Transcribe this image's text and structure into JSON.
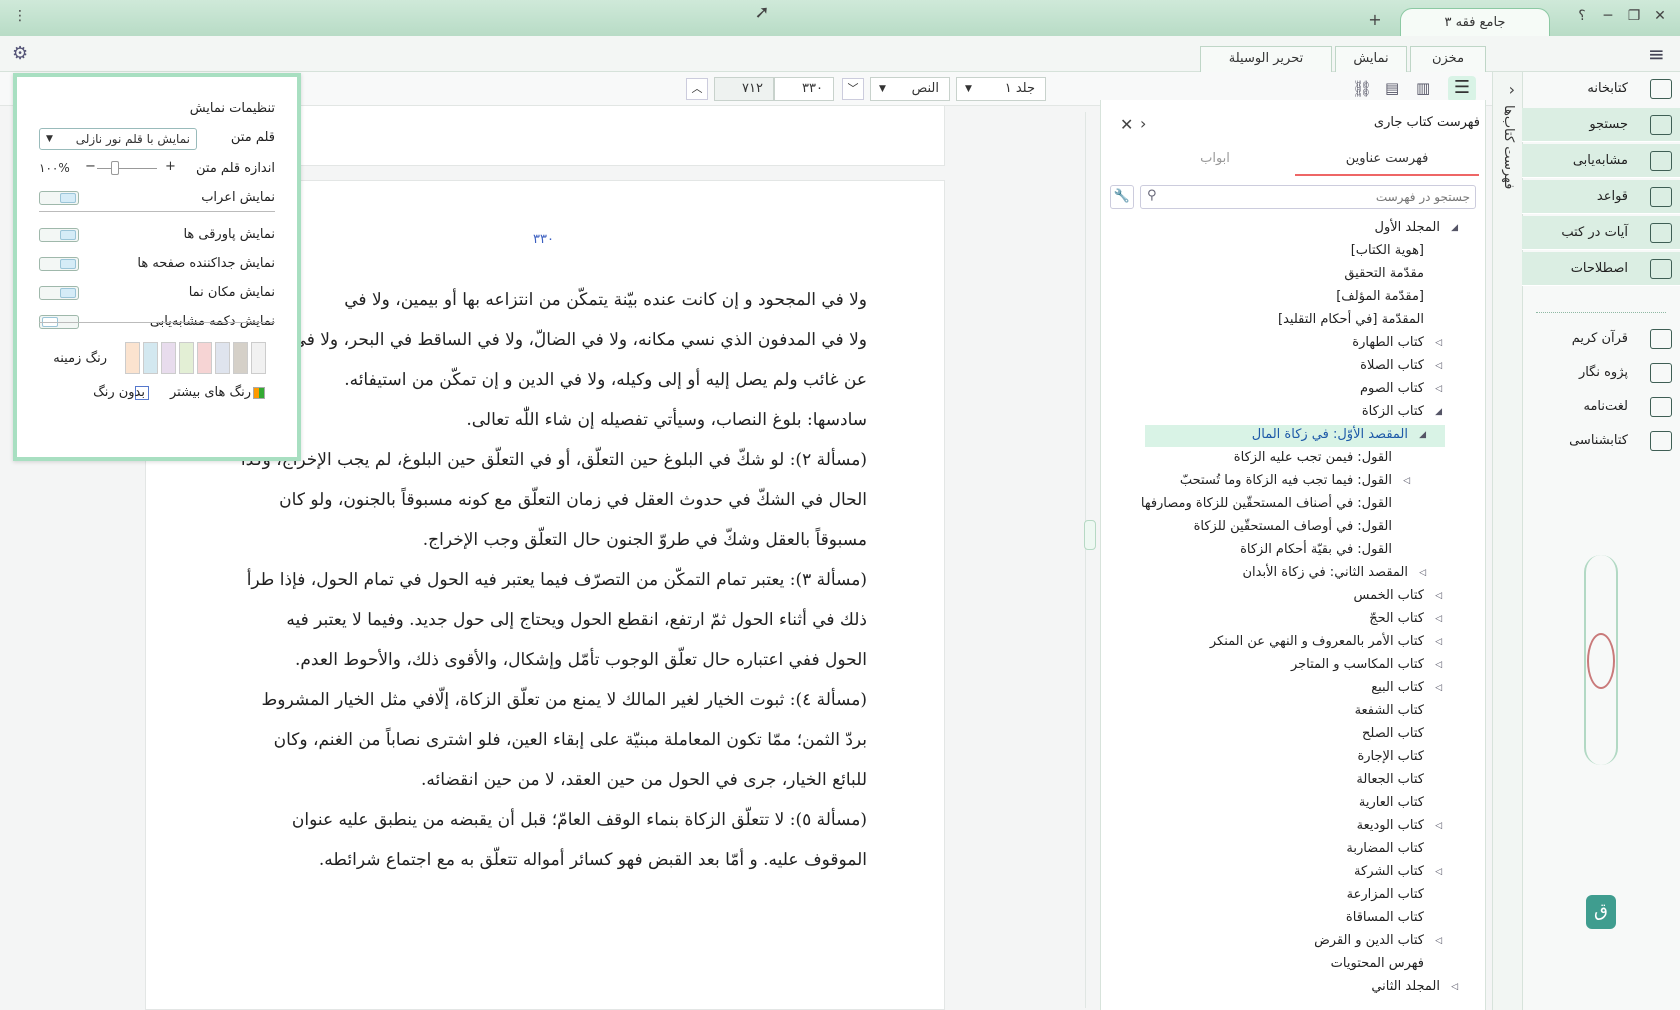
{
  "window": {
    "title": "جامع فقه ۳",
    "add_tab": "+",
    "help": "؟",
    "menu": "⋮"
  },
  "top_tabs": {
    "store": "مخزن",
    "display": "نمایش",
    "tahrir": "تحرير الوسيلة"
  },
  "sidebar": {
    "items": [
      {
        "label": "کتابخانه",
        "icon": "library-icon"
      },
      {
        "label": "جستجو",
        "icon": "search-icon"
      },
      {
        "label": "مشابه‌یابی",
        "icon": "similarity-icon"
      },
      {
        "label": "قواعد",
        "icon": "rules-icon"
      },
      {
        "label": "آیات در کتب",
        "icon": "verses-icon"
      },
      {
        "label": "اصطلاحات",
        "icon": "terms-icon"
      },
      {
        "label": "قرآن کریم",
        "icon": "quran-icon"
      },
      {
        "label": "پژوه نگار",
        "icon": "notes-icon"
      },
      {
        "label": "لغت‌نامه",
        "icon": "dictionary-icon"
      },
      {
        "label": "کتابشناسی",
        "icon": "bibliography-icon"
      }
    ]
  },
  "vertical_tab": "فهرست کتاب‌ها",
  "toc": {
    "title": "فهرست کتاب جاری",
    "tabs": [
      "فهرست عناوین",
      "ابواب"
    ],
    "search_placeholder": "جستجو در فهرست",
    "items": [
      "المجلد الأول",
      "[هوية الكتاب]",
      "مقدّمة التحقيق",
      "[مقدّمة المؤلف]",
      "المقدّمة [في أحكام التقليد]",
      "كتاب الطهارة",
      "كتاب الصلاة",
      "كتاب الصوم",
      "كتاب الزكاة",
      "المقصد الأوّل: في زكاة المال",
      "القول: فيمن تجب عليه الزكاة",
      "القول: فيما تجب فيه الزكاة وما تُستحبّ",
      "القول: في أصناف المستحقّين للزكاة ومصارفها",
      "القول: في أوصاف المستحقّين للزكاة",
      "القول: في بقيّة أحكام الزكاة",
      "المقصد الثاني: في زكاة الأبدان",
      "كتاب الخمس",
      "كتاب الحجّ",
      "كتاب الأمر بالمعروف و النهي عن المنكر",
      "كتاب المكاسب و المتاجر",
      "كتاب البيع",
      "كتاب الشفعة",
      "كتاب الصلح",
      "كتاب الإجارة",
      "كتاب الجعالة",
      "كتاب العارية",
      "كتاب الوديعة",
      "كتاب المضاربة",
      "كتاب الشركة",
      "كتاب المزارعة",
      "كتاب المساقاة",
      "كتاب الدين و القرض",
      "فهرس المحتويات",
      "المجلد الثاني"
    ]
  },
  "nav": {
    "volume": "جلد ۱",
    "section": "النص",
    "page": "۳۳۰",
    "total": "۷۱۲"
  },
  "page_number": "۳۳۰",
  "text_lines": [
    "ولا في المجحود و إن كانت عنده بيّنة يتمكّن من انتزاعه بها أو بيمين، ولا في",
    "ولا في المدفون الذي نسي مكانه، ولا في الضالّ، ولا في الساقط في البحر، ولا في",
    "عن غائب ولم يصل إليه أو إلى وكيله، ولا في الدين و إن تمكّن من استيفائه.",
    "سادسها: بلوغ النصاب، وسيأتي تفصيله إن شاء اللّٰه تعالى.",
    "(مسألة ٢): لو شكّ في البلوغ حين التعلّق، أو في التعلّق حين البلوغ، لم يجب الإخراج، وكذا",
    "الحال في الشكّ في حدوث العقل في زمان التعلّق مع كونه مسبوقاً بالجنون، ولو كان",
    "مسبوقاً بالعقل وشكّ في طروّ الجنون حال التعلّق وجب الإخراج.",
    "(مسألة ٣): يعتبر تمام التمكّن من التصرّف فيما يعتبر فيه الحول في تمام الحول، فإذا طرأ",
    "ذلك في أثناء الحول ثمّ ارتفع، انقطع الحول ويحتاج إلى حول جديد. وفيما لا يعتبر فيه",
    "الحول ففي اعتباره حال تعلّق الوجوب تأمّل وإشكال، والأقوى ذلك، والأحوط العدم.",
    "(مسألة ٤): ثبوت الخيار لغير المالك لا يمنع من تعلّق الزكاة، إلّافي مثل الخيار المشروط",
    "بردّ الثمن؛ ممّا تكون المعاملة مبنيّة على إبقاء العين، فلو اشترى نصاباً من الغنم، وكان",
    "للبائع الخيار، جرى في الحول من حين العقد، لا من حين انقضائه.",
    "(مسألة ٥): لا تتعلّق الزكاة بنماء الوقف العامّ؛ قبل أن يقبضه من ينطبق عليه عنوان",
    "الموقوف عليه. و أمّا بعد القبض فهو كسائر أمواله تتعلّق به مع اجتماع شرائطه."
  ],
  "settings": {
    "title": "تنظیمات نمایش",
    "font_label": "قلم متن",
    "font_value": "نمایش با قلم نور نازلی",
    "size_label": "اندازه قلم متن",
    "size_value": "۱۰۰%",
    "size_fraction": 0.3,
    "toggles": [
      {
        "label": "نمایش اعراب",
        "on": true
      },
      {
        "label": "نمایش پاورقی ها",
        "on": true
      },
      {
        "label": "نمایش جداکننده صفحه ها",
        "on": true
      },
      {
        "label": "نمایش مکان نما",
        "on": true
      },
      {
        "label": "نمایش دکمه مشابه‌یابی",
        "on": false
      }
    ],
    "bg_label": "رنگ زمینه",
    "more_colors": "رنگ های بیشتر",
    "no_color": "بدون رنگ",
    "swatches": [
      "#fbe3cf",
      "#d3e8f0",
      "#e8dced",
      "#e3efd5",
      "#f6d4d4",
      "#dfe4ee",
      "#d5d0c8",
      "#f1f1f1"
    ]
  },
  "colors": {
    "accent": "#a8dfc1",
    "highlight": "#d9f3e6"
  }
}
